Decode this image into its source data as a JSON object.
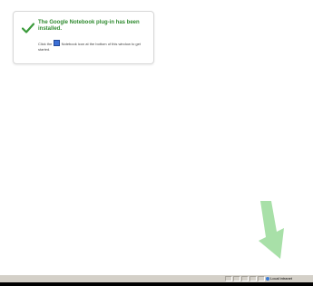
{
  "notice": {
    "title": "The Google Notebook plug-in has been installed.",
    "body_before_icon": "Click the",
    "body_after_icon": "Notebook icon at the bottom of this window to get started.",
    "icons": {
      "check": "checkmark-icon",
      "notebook": "notebook-icon"
    }
  },
  "hint_arrow": {
    "icon": "down-right-arrow-icon",
    "color": "#a8e0a8"
  },
  "statusbar": {
    "zone_text": "Local intranet",
    "zone_icon": "intranet-zone-icon"
  },
  "colors": {
    "title_green": "#2f8a2f",
    "statusbar_gray": "#d4d0c8"
  }
}
